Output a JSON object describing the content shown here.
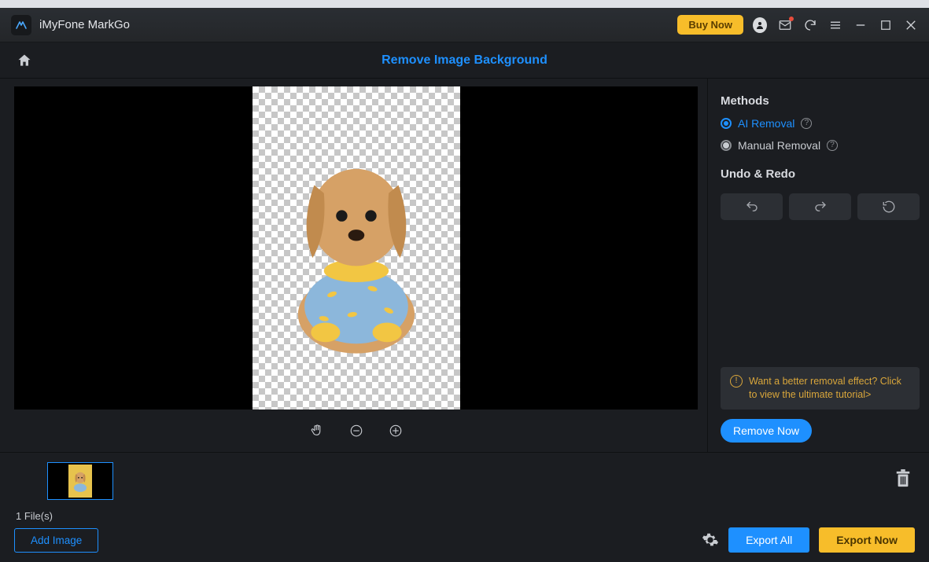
{
  "titlebar": {
    "app_name": "iMyFone MarkGo",
    "buy_now": "Buy Now"
  },
  "header": {
    "page_title": "Remove Image Background"
  },
  "side": {
    "methods_label": "Methods",
    "ai_removal": "AI Removal",
    "manual_removal": "Manual Removal",
    "undo_redo_label": "Undo & Redo",
    "tutorial_text": "Want a better removal effect? Click to view the ultimate tutorial>",
    "remove_now": "Remove Now"
  },
  "bottom": {
    "file_count": "1 File(s)",
    "add_image": "Add Image",
    "export_all": "Export All",
    "export_now": "Export Now"
  }
}
